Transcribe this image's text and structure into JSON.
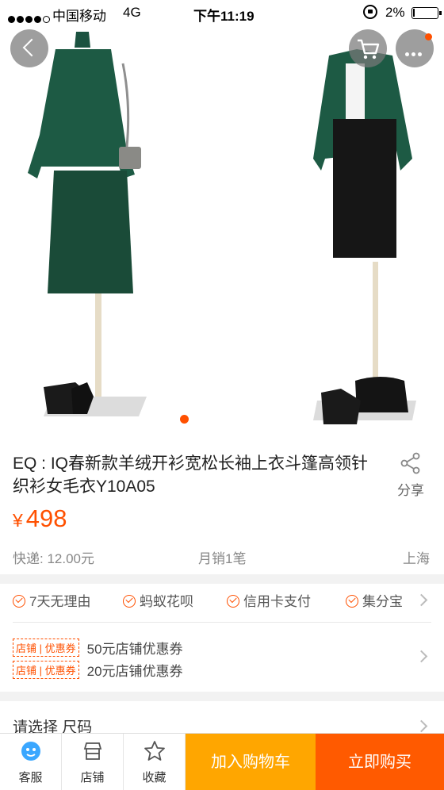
{
  "status_bar": {
    "carrier": "中国移动",
    "network": "4G",
    "time": "下午11:19",
    "battery": "2%"
  },
  "product": {
    "title": "EQ : IQ春新款羊绒开衫宽松长袖上衣斗篷高领针织衫女毛衣Y10A05",
    "price_symbol": "¥",
    "price": "498",
    "shipping": "快递: 12.00元",
    "monthly_sales": "月销1笔",
    "location": "上海",
    "share_label": "分享"
  },
  "guarantees": [
    "7天无理由",
    "蚂蚁花呗",
    "信用卡支付",
    "集分宝"
  ],
  "coupons": [
    {
      "tag": "店铺 | 优惠券",
      "text": "50元店铺优惠券"
    },
    {
      "tag": "店铺 | 优惠券",
      "text": "20元店铺优惠券"
    }
  ],
  "select_prompt": "请选择 尺码",
  "bottom_bar": {
    "service": "客服",
    "shop": "店铺",
    "favorite": "收藏",
    "add_to_cart": "加入购物车",
    "buy_now": "立即购买"
  },
  "colors": {
    "accent": "#ff5000",
    "cart_button": "#ffa600",
    "buy_button": "#ff5a00",
    "garment_green": "#1d5a44"
  },
  "icons": [
    "back-icon",
    "cart-icon",
    "more-icon",
    "share-icon",
    "service-icon",
    "shop-icon",
    "star-icon",
    "check-icon",
    "chevron-right-icon"
  ]
}
